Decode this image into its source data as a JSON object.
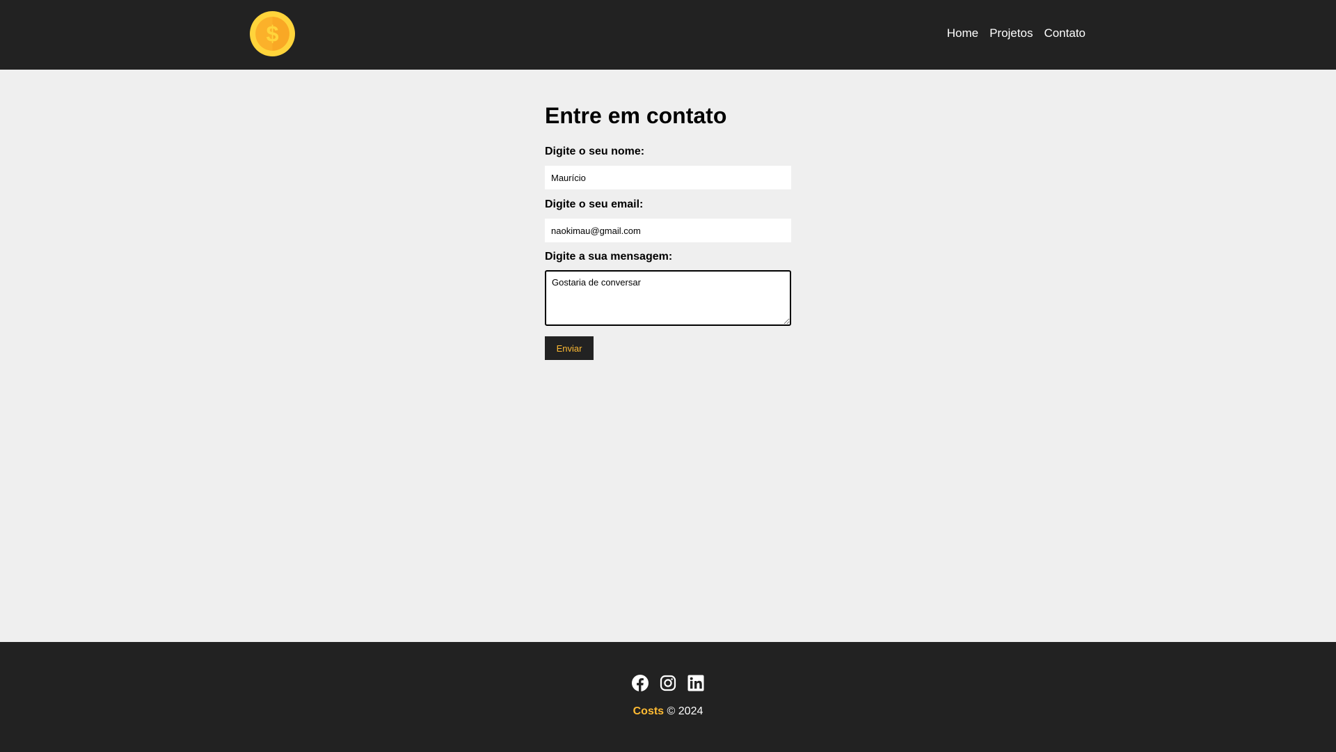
{
  "navbar": {
    "logo_icon": "gold-dollar-coin-icon",
    "links": [
      {
        "label": "Home"
      },
      {
        "label": "Projetos"
      },
      {
        "label": "Contato"
      }
    ]
  },
  "main": {
    "title": "Entre em contato",
    "form": {
      "name_label": "Digite o seu nome:",
      "name_value": "Maurício",
      "email_label": "Digite o seu email:",
      "email_value": "naokimau@gmail.com",
      "message_label": "Digite a sua mensagem:",
      "message_value": "Gostaria de conversar",
      "submit_label": "Enviar"
    }
  },
  "footer": {
    "social_icons": [
      "facebook-icon",
      "instagram-icon",
      "linkedin-icon"
    ],
    "brand": "Costs",
    "copyright": "© 2024"
  },
  "colors": {
    "dark": "#222222",
    "accent": "#ffbb33",
    "background": "#efefef"
  }
}
